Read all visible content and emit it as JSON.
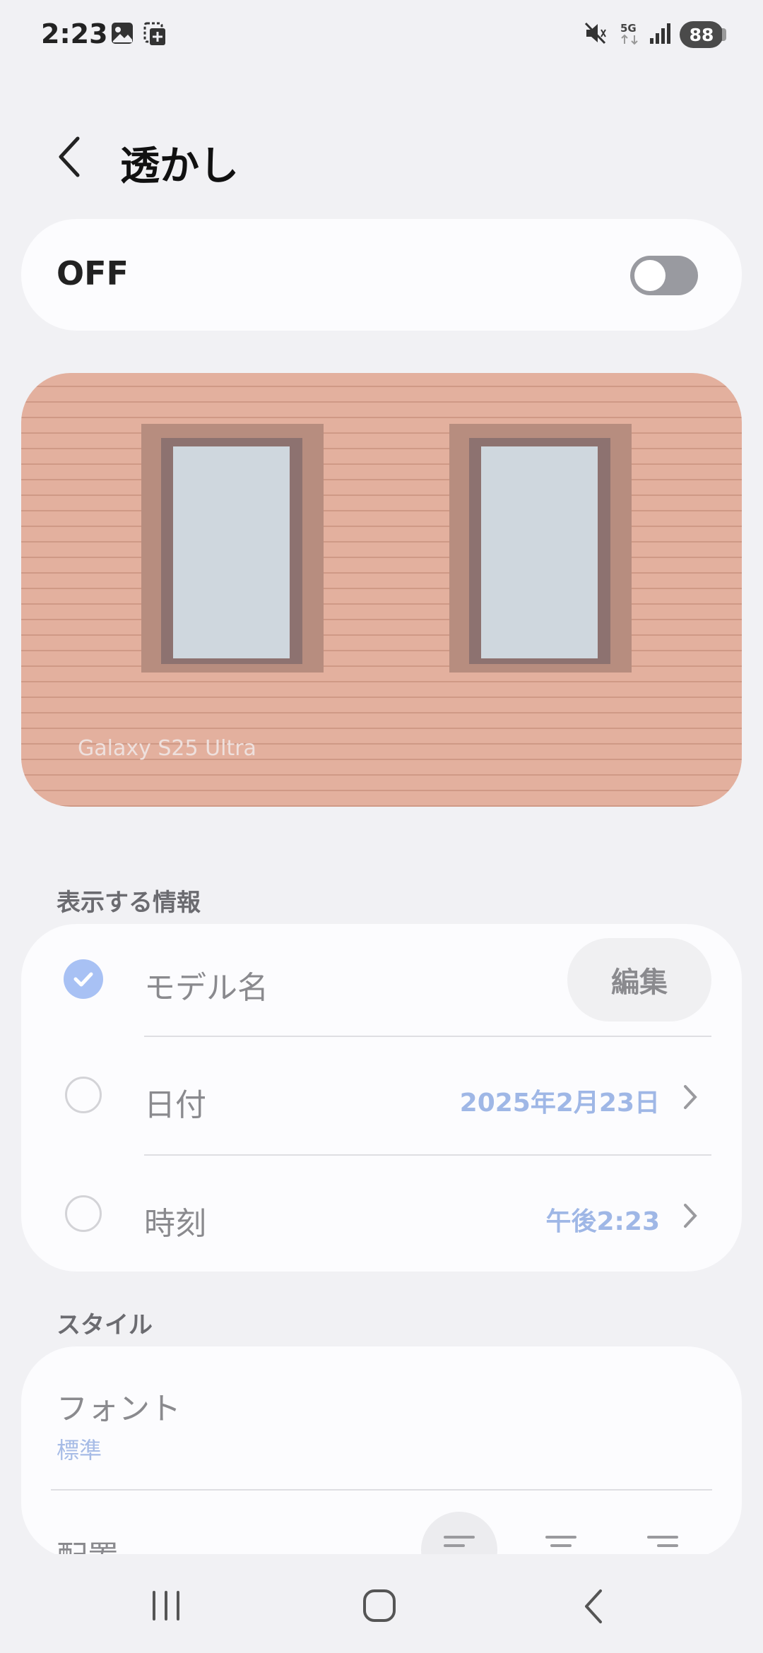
{
  "status_bar": {
    "time": "2:23",
    "battery": "88",
    "network": "5G",
    "icons": [
      "gallery-icon",
      "screenshot-icon",
      "mute-icon",
      "network-5g-icon",
      "signal-icon",
      "battery-icon"
    ]
  },
  "header": {
    "back_icon": "chevron-left-icon",
    "title": "透かし"
  },
  "master_toggle": {
    "label": "OFF",
    "state": "off"
  },
  "preview": {
    "watermark_text": "Galaxy S25 Ultra"
  },
  "info_section": {
    "title": "表示する情報",
    "items": [
      {
        "label": "モデル名",
        "checked": true,
        "action": "編集"
      },
      {
        "label": "日付",
        "checked": false,
        "value": "2025年2月23日"
      },
      {
        "label": "時刻",
        "checked": false,
        "value": "午後2:23"
      }
    ]
  },
  "style_section": {
    "title": "スタイル",
    "font": {
      "label": "フォント",
      "value": "標準"
    },
    "alignment": {
      "label": "配置",
      "options": [
        "align-left-icon",
        "align-center-icon",
        "align-right-icon"
      ],
      "selected": "align-left-icon"
    }
  },
  "nav_bar": {
    "buttons": [
      "recent-apps-icon",
      "home-icon",
      "back-icon"
    ]
  },
  "colors": {
    "background": "#f1f1f4",
    "card": "#fcfcfe",
    "accent": "#9fb7e6",
    "check_on": "#a8c1f4",
    "toggle_off": "#999aa0"
  }
}
